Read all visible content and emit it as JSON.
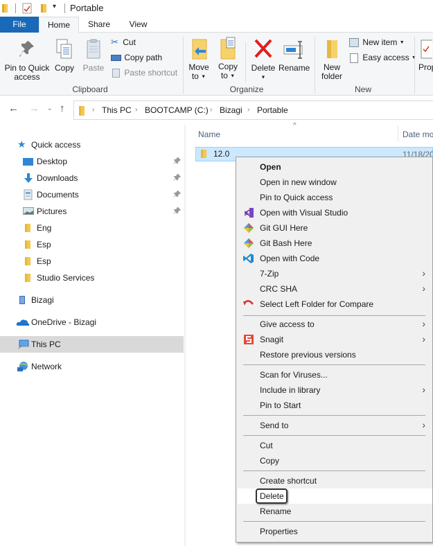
{
  "window": {
    "title": "Portable"
  },
  "ribbon_tabs": [
    {
      "label": "File"
    },
    {
      "label": "Home"
    },
    {
      "label": "Share"
    },
    {
      "label": "View"
    }
  ],
  "ribbon": {
    "clipboard": {
      "group_label": "Clipboard",
      "pin_label_1": "Pin to Quick",
      "pin_label_2": "access",
      "copy_label": "Copy",
      "paste_label": "Paste",
      "cut_label": "Cut",
      "copy_path_label": "Copy path",
      "paste_shortcut_label": "Paste shortcut"
    },
    "organize": {
      "group_label": "Organize",
      "move_label_1": "Move",
      "move_label_2": "to",
      "copyto_label_1": "Copy",
      "copyto_label_2": "to",
      "delete_label": "Delete",
      "rename_label": "Rename"
    },
    "new": {
      "group_label": "New",
      "new_folder_1": "New",
      "new_folder_2": "folder",
      "new_item_label": "New item",
      "easy_access_label": "Easy access"
    },
    "open": {
      "properties_label": "Prop"
    }
  },
  "address": {
    "crumbs": [
      "This PC",
      "BOOTCAMP (C:)",
      "Bizagi",
      "Portable"
    ]
  },
  "sidebar": {
    "items": [
      {
        "label": "Quick access",
        "icon": "star-icon"
      },
      {
        "label": "Desktop",
        "icon": "desktop-icon",
        "pinned": true
      },
      {
        "label": "Downloads",
        "icon": "download-icon",
        "pinned": true
      },
      {
        "label": "Documents",
        "icon": "documents-icon",
        "pinned": true
      },
      {
        "label": "Pictures",
        "icon": "pictures-icon",
        "pinned": true
      },
      {
        "label": "Eng",
        "icon": "folder-icon"
      },
      {
        "label": "Esp",
        "icon": "folder-icon"
      },
      {
        "label": "Esp",
        "icon": "folder-icon"
      },
      {
        "label": "Studio Services",
        "icon": "folder-icon"
      },
      {
        "label": "Bizagi",
        "icon": "building-icon"
      },
      {
        "label": "OneDrive - Bizagi",
        "icon": "cloud-icon"
      },
      {
        "label": "This PC",
        "icon": "computer-icon",
        "selected": true
      },
      {
        "label": "Network",
        "icon": "network-icon"
      }
    ]
  },
  "file_list": {
    "columns": [
      "Name",
      "Date mo"
    ],
    "rows": [
      {
        "name": "12.0",
        "date": "11/18/20"
      }
    ]
  },
  "context_menu": {
    "items": [
      {
        "label": "Open",
        "bold": true
      },
      {
        "label": "Open in new window"
      },
      {
        "label": "Pin to Quick access"
      },
      {
        "label": "Open with Visual Studio",
        "icon": "visual-studio-icon"
      },
      {
        "label": "Git GUI Here",
        "icon": "git-icon"
      },
      {
        "label": "Git Bash Here",
        "icon": "git-icon"
      },
      {
        "label": "Open with Code",
        "icon": "vscode-icon"
      },
      {
        "label": "7-Zip",
        "submenu": true
      },
      {
        "label": "CRC SHA",
        "submenu": true
      },
      {
        "label": "Select Left Folder for Compare",
        "icon": "compare-icon"
      },
      {
        "label": "Give access to",
        "submenu": true
      },
      {
        "label": "Snagit",
        "icon": "snagit-icon",
        "submenu": true
      },
      {
        "label": "Restore previous versions"
      },
      {
        "label": "Scan for Viruses..."
      },
      {
        "label": "Include in library",
        "submenu": true
      },
      {
        "label": "Pin to Start"
      },
      {
        "label": "Send to",
        "submenu": true
      },
      {
        "label": "Cut"
      },
      {
        "label": "Copy"
      },
      {
        "label": "Create shortcut"
      },
      {
        "label": "Delete",
        "highlighted": true
      },
      {
        "label": "Rename"
      },
      {
        "label": "Properties"
      }
    ],
    "submenu_arrow": "›"
  },
  "colors": {
    "file_tab": "#1969b8",
    "selection": "#cce8ff",
    "menu_bg": "#f0f0f0"
  }
}
